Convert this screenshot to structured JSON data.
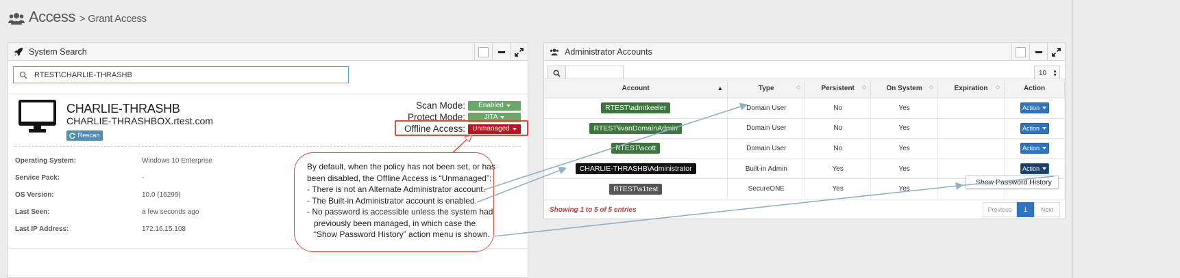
{
  "header": {
    "title": "Access",
    "breadcrumb": "> Grant Access",
    "icon": "users-icon"
  },
  "system_search": {
    "title": "System Search",
    "search_value": "RTEST\\CHARLIE-THRASHB",
    "hostname": "CHARLIE-THRASHB",
    "fqdn": "CHARLIE-THRASHBOX.rtest.com",
    "rescan_label": "Rescan",
    "modes": [
      {
        "label": "Scan Mode:",
        "value": "Enabled",
        "color": "#6aa86a"
      },
      {
        "label": "Protect Mode:",
        "value": "JITA",
        "color": "#6aa86a"
      },
      {
        "label": "Offline Access:",
        "value": "Unmanaged",
        "color": "#c1121f"
      }
    ],
    "info": [
      {
        "key": "Operating System:",
        "value": "Windows 10 Enterprise"
      },
      {
        "key": "Service Pack:",
        "value": "-"
      },
      {
        "key": "OS Version:",
        "value": "10.0 (16299)"
      },
      {
        "key": "Last Seen:",
        "value": "a few seconds ago"
      },
      {
        "key": "Last IP Address:",
        "value": "172.16.15.108"
      }
    ]
  },
  "admin_accounts": {
    "title": "Administrator Accounts",
    "page_size": "10",
    "columns": [
      "Account",
      "Type",
      "Persistent",
      "On System",
      "Expiration",
      "Action"
    ],
    "rows": [
      {
        "account": "RTEST\\admtkeeler",
        "type": "Domain User",
        "persistent": "No",
        "on_system": "Yes",
        "expiration": "",
        "action": "Action"
      },
      {
        "account": "RTEST\\ivanDomainAdmin",
        "type": "Domain User",
        "persistent": "No",
        "on_system": "Yes",
        "expiration": "",
        "action": "Action"
      },
      {
        "account": "RTEST\\scott",
        "type": "Domain User",
        "persistent": "No",
        "on_system": "Yes",
        "expiration": "",
        "action": "Action"
      },
      {
        "account": "CHARLIE-THRASHB\\Administrator",
        "type": "Built-in Admin",
        "persistent": "Yes",
        "on_system": "Yes",
        "expiration": "",
        "action": "Action"
      },
      {
        "account": "RTEST\\s1test",
        "type": "SecureONE",
        "persistent": "Yes",
        "on_system": "Yes",
        "expiration": "",
        "action": ""
      }
    ],
    "showing": "Showing 1 to 5 of 5 entries",
    "pager": {
      "previous": "Previous",
      "page": "1",
      "next": "Next"
    },
    "menu_item": "Show Password History",
    "colors": {
      "domain_tag": "#3c763d",
      "builtin_tag": "#111111",
      "secureone_tag": "#555555",
      "action": "#2f74c0"
    }
  },
  "callout": {
    "lines": [
      "By default, when the policy has not been set, or has",
      "been disabled, the Offline Access is “Unmanaged”:",
      "- There is not an Alternate Administrator account.",
      "- The Built-in Administrator account is enabled.",
      "- No password is accessible unless the system had",
      "previously been managed, in which case the",
      "“Show  Password History” action menu is shown."
    ]
  }
}
